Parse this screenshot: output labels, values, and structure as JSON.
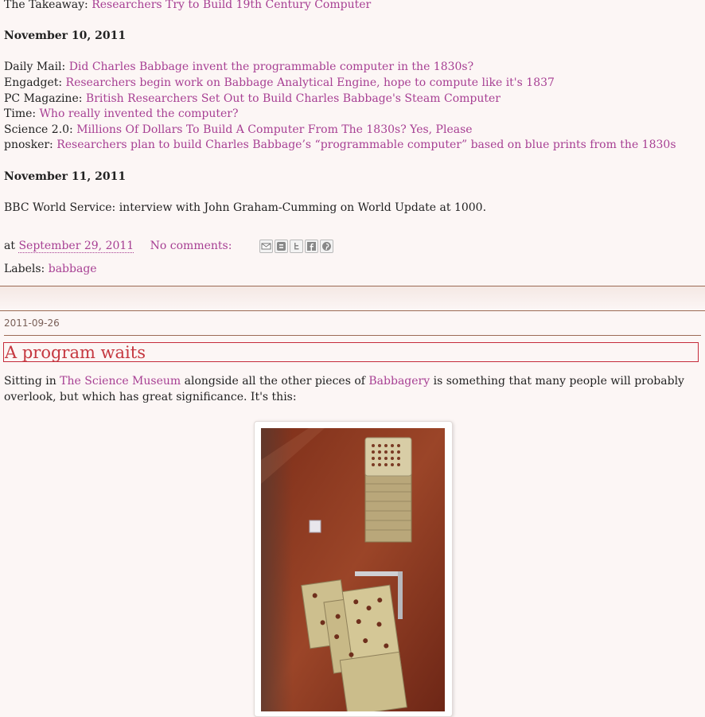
{
  "prev_post": {
    "takeaway_prefix": "The Takeaway: ",
    "takeaway_link": "Researchers Try to Build 19th Century Computer",
    "date_nov10": "November 10, 2011",
    "entries": [
      {
        "source": "Daily Mail: ",
        "link": "Did Charles Babbage invent the programmable computer in the 1830s?"
      },
      {
        "source": "Engadget: ",
        "link": "Researchers begin work on Babbage Analytical Engine, hope to compute like it's 1837"
      },
      {
        "source": "PC Magazine: ",
        "link": "British Researchers Set Out to Build Charles Babbage's Steam Computer"
      },
      {
        "source": "Time: ",
        "link": "Who really invented the computer?"
      },
      {
        "source": "Science 2.0: ",
        "link": "Millions Of Dollars To Build A Computer From The 1830s? Yes, Please"
      },
      {
        "source": "pnosker: ",
        "link": "Researchers plan to build Charles Babbage’s “programmable computer” based on blue prints from the 1830s"
      }
    ],
    "date_nov11": "November 11, 2011",
    "bbc_text": "BBC World Service: interview with John Graham-Cumming on World Update at 1000.",
    "footer": {
      "at_label": "at ",
      "timestamp": "September 29, 2011",
      "comments": "No comments:",
      "labels_prefix": "Labels: ",
      "label": "babbage"
    }
  },
  "next_post": {
    "date_header": "2011-09-26",
    "title": "A program waits",
    "body_1": "Sitting in ",
    "link_1": "The Science Museum",
    "body_2": " alongside all the other pieces of ",
    "link_2": "Babbagery",
    "body_3": " is something that many people will probably",
    "body_line2": "overlook, but which has great significance. It's this:"
  },
  "share_icons": [
    "email-icon",
    "blogger-icon",
    "twitter-icon",
    "facebook-icon",
    "pinterest-icon"
  ],
  "colors": {
    "link": "#a73f93",
    "title": "#c5373f",
    "background": "#fcf6f5",
    "divider": "#9c6b55"
  }
}
